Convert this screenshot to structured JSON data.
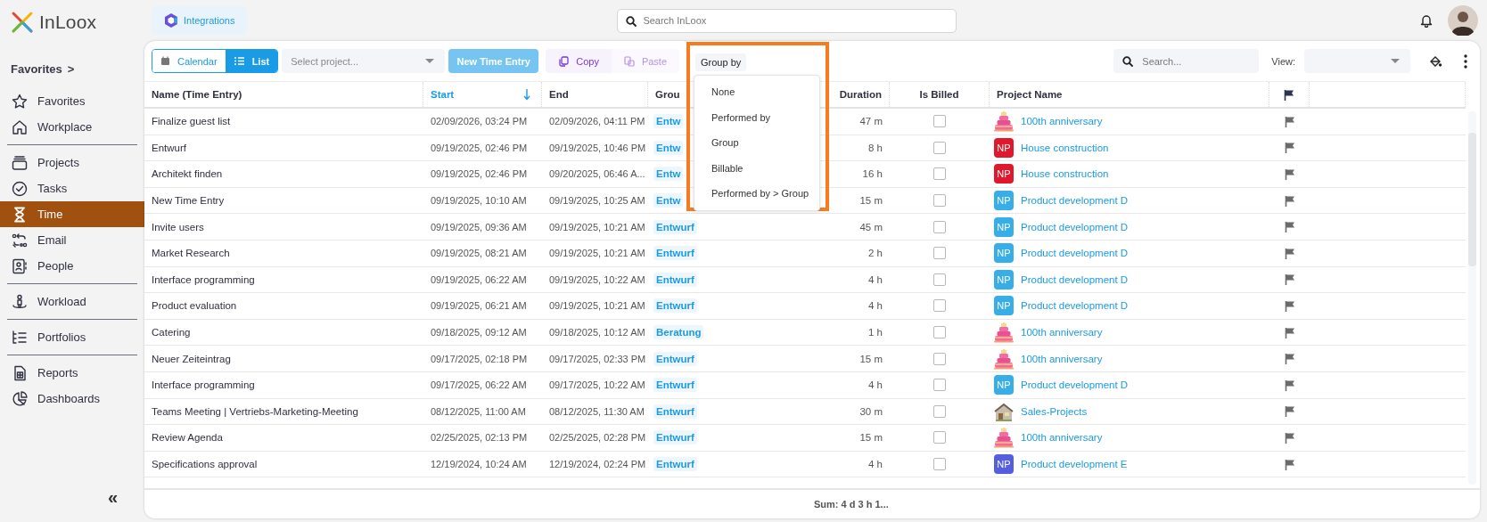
{
  "logo": {
    "text": "InLoox"
  },
  "sidebar": {
    "heading": "Favorites",
    "chevron": ">",
    "sections": [
      {
        "items": [
          {
            "label": "Favorites",
            "selected": false
          },
          {
            "label": "Workplace",
            "selected": false
          }
        ]
      },
      {
        "items": [
          {
            "label": "Projects",
            "selected": false
          },
          {
            "label": "Tasks",
            "selected": false
          },
          {
            "label": "Time",
            "selected": true
          },
          {
            "label": "Email",
            "selected": false
          },
          {
            "label": "People",
            "selected": false
          }
        ]
      },
      {
        "items": [
          {
            "label": "Workload",
            "selected": false
          }
        ]
      },
      {
        "items": [
          {
            "label": "Portfolios",
            "selected": false
          }
        ]
      },
      {
        "items": [
          {
            "label": "Reports",
            "selected": false
          },
          {
            "label": "Dashboards",
            "selected": false
          }
        ]
      }
    ],
    "collapse": "«"
  },
  "topbar": {
    "integrations": "Integrations",
    "search": {
      "placeholder": "Search InLoox"
    }
  },
  "toolbar": {
    "view_toggle": [
      {
        "label": "Calendar",
        "selected": false
      },
      {
        "label": "List",
        "selected": true
      }
    ],
    "project_select": {
      "placeholder": "Select project..."
    },
    "new_entry": {
      "label": "New Time Entry",
      "disabled": true
    },
    "copy": {
      "label": "Copy",
      "disabled": false
    },
    "paste": {
      "label": "Paste",
      "disabled": true
    },
    "group_by": {
      "label": "Group by",
      "expanded": true,
      "highlighted": true,
      "options": [
        "None",
        "Performed by",
        "Group",
        "Billable",
        "Performed by > Group"
      ]
    },
    "search": {
      "placeholder": "Search..."
    },
    "view": {
      "label": "View:"
    }
  },
  "table": {
    "columns": [
      {
        "label": "Name (Time Entry)",
        "kind": "text",
        "sorted": false
      },
      {
        "label": "Start",
        "kind": "text",
        "sorted": true
      },
      {
        "label": "End",
        "kind": "text",
        "sorted": false
      },
      {
        "label": "Grou",
        "kind": "text",
        "sorted": false
      },
      {
        "label": "Duration",
        "kind": "number",
        "sorted": false
      },
      {
        "label": "Is Billed",
        "kind": "check",
        "sorted": false
      },
      {
        "label": "Project Name",
        "kind": "text",
        "sorted": false
      },
      {
        "kind": "flag",
        "sorted": false
      }
    ],
    "rows": [
      {
        "name": "Finalize guest list",
        "start": "02/09/2026, 03:24 PM",
        "end": "02/09/2026, 04:11 PM",
        "group": "Entw",
        "duration": "47 m",
        "billed": false,
        "project": {
          "name": "100th anniversary",
          "kind": "cake"
        }
      },
      {
        "name": "Entwurf",
        "start": "09/19/2025, 02:46 PM",
        "end": "09/19/2025, 10:46 PM",
        "group": "Entw",
        "duration": "8 h",
        "billed": false,
        "project": {
          "name": "House construction",
          "kind": "badge",
          "initials": "NP",
          "color": "#e0182d"
        }
      },
      {
        "name": "Architekt finden",
        "start": "09/19/2025, 02:46 PM",
        "end": "09/20/2025, 06:46 A...",
        "group": "Entw",
        "duration": "16 h",
        "billed": false,
        "project": {
          "name": "House construction",
          "kind": "badge",
          "initials": "NP",
          "color": "#e0182d"
        }
      },
      {
        "name": "New Time Entry",
        "start": "09/19/2025, 10:10 AM",
        "end": "09/19/2025, 10:25 AM",
        "group": "Entw",
        "duration": "15 m",
        "billed": false,
        "project": {
          "name": "Product development D",
          "kind": "badge",
          "initials": "NP",
          "color": "#37aee8"
        }
      },
      {
        "name": "Invite users",
        "start": "09/19/2025, 09:36 AM",
        "end": "09/19/2025, 10:21 AM",
        "group": "Entwurf",
        "duration": "45 m",
        "billed": false,
        "project": {
          "name": "Product development D",
          "kind": "badge",
          "initials": "NP",
          "color": "#37aee8"
        }
      },
      {
        "name": "Market Research",
        "start": "09/19/2025, 08:21 AM",
        "end": "09/19/2025, 10:21 AM",
        "group": "Entwurf",
        "duration": "2 h",
        "billed": false,
        "project": {
          "name": "Product development D",
          "kind": "badge",
          "initials": "NP",
          "color": "#37aee8"
        }
      },
      {
        "name": "Interface programming",
        "start": "09/19/2025, 06:22 AM",
        "end": "09/19/2025, 10:22 AM",
        "group": "Entwurf",
        "duration": "4 h",
        "billed": false,
        "project": {
          "name": "Product development D",
          "kind": "badge",
          "initials": "NP",
          "color": "#37aee8"
        }
      },
      {
        "name": "Product evaluation",
        "start": "09/19/2025, 06:21 AM",
        "end": "09/19/2025, 10:21 AM",
        "group": "Entwurf",
        "duration": "4 h",
        "billed": false,
        "project": {
          "name": "Product development D",
          "kind": "badge",
          "initials": "NP",
          "color": "#37aee8"
        }
      },
      {
        "name": "Catering",
        "start": "09/18/2025, 09:12 AM",
        "end": "09/18/2025, 10:12 AM",
        "group": "Beratung",
        "duration": "1 h",
        "billed": false,
        "project": {
          "name": "100th anniversary",
          "kind": "cake"
        }
      },
      {
        "name": "Neuer Zeiteintrag",
        "start": "09/17/2025, 02:18 PM",
        "end": "09/17/2025, 02:33 PM",
        "group": "Entwurf",
        "duration": "15 m",
        "billed": false,
        "project": {
          "name": "100th anniversary",
          "kind": "cake"
        }
      },
      {
        "name": "Interface programming",
        "start": "09/17/2025, 06:22 AM",
        "end": "09/17/2025, 10:22 AM",
        "group": "Entwurf",
        "duration": "4 h",
        "billed": false,
        "project": {
          "name": "Product development D",
          "kind": "badge",
          "initials": "NP",
          "color": "#37aee8"
        }
      },
      {
        "name": "Teams Meeting | Vertriebs-Marketing-Meeting",
        "start": "08/12/2025, 11:00 AM",
        "end": "08/12/2025, 11:30 AM",
        "group": "Entwurf",
        "duration": "30 m",
        "billed": false,
        "project": {
          "name": "Sales-Projects",
          "kind": "house"
        }
      },
      {
        "name": "Review Agenda",
        "start": "02/25/2025, 02:13 PM",
        "end": "02/25/2025, 02:28 PM",
        "group": "Entwurf",
        "duration": "15 m",
        "billed": false,
        "project": {
          "name": "100th anniversary",
          "kind": "cake"
        }
      },
      {
        "name": "Specifications approval",
        "start": "12/19/2024, 10:24 AM",
        "end": "12/19/2024, 02:24 PM",
        "group": "Entwurf",
        "duration": "4 h",
        "billed": false,
        "project": {
          "name": "Product development E",
          "kind": "badge",
          "initials": "NP",
          "color": "#565ee0"
        }
      }
    ],
    "footer": "Sum: 4 d 3 h 1..."
  }
}
